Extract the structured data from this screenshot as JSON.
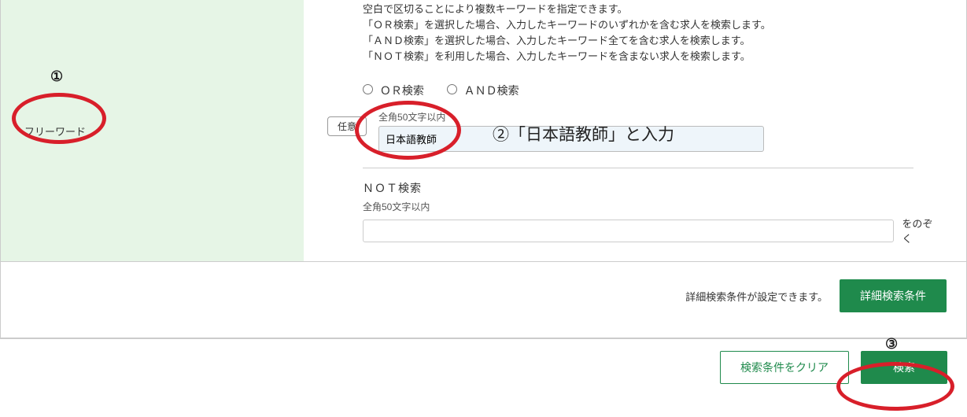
{
  "sidebar": {
    "label": "フリーワード"
  },
  "hints": {
    "line1": "空白で区切ることにより複数キーワードを指定できます。",
    "line2": "「ＯＲ検索」を選択した場合、入力したキーワードのいずれかを含む求人を検索します。",
    "line3": "「ＡＮＤ検索」を選択した場合、入力したキーワード全てを含む求人を検索します。",
    "line4": "「ＮＯＴ検索」を利用した場合、入力したキーワードを含まない求人を検索します。"
  },
  "radio": {
    "or_label": "ＯＲ検索",
    "and_label": "ＡＮＤ検索"
  },
  "optional_badge": "任意",
  "input": {
    "limit": "全角50文字以内",
    "value": "日本語教師"
  },
  "not_section": {
    "label": "ＮＯＴ検索",
    "limit": "全角50文字以内",
    "suffix": "をのぞく"
  },
  "footer": {
    "note": "詳細検索条件が設定できます。",
    "detail_button": "詳細検索条件",
    "clear_button": "検索条件をクリア",
    "search_button": "検索"
  },
  "annotations": {
    "num1": "①",
    "num2_text": "②「日本語教師」と入力",
    "num3": "③"
  }
}
